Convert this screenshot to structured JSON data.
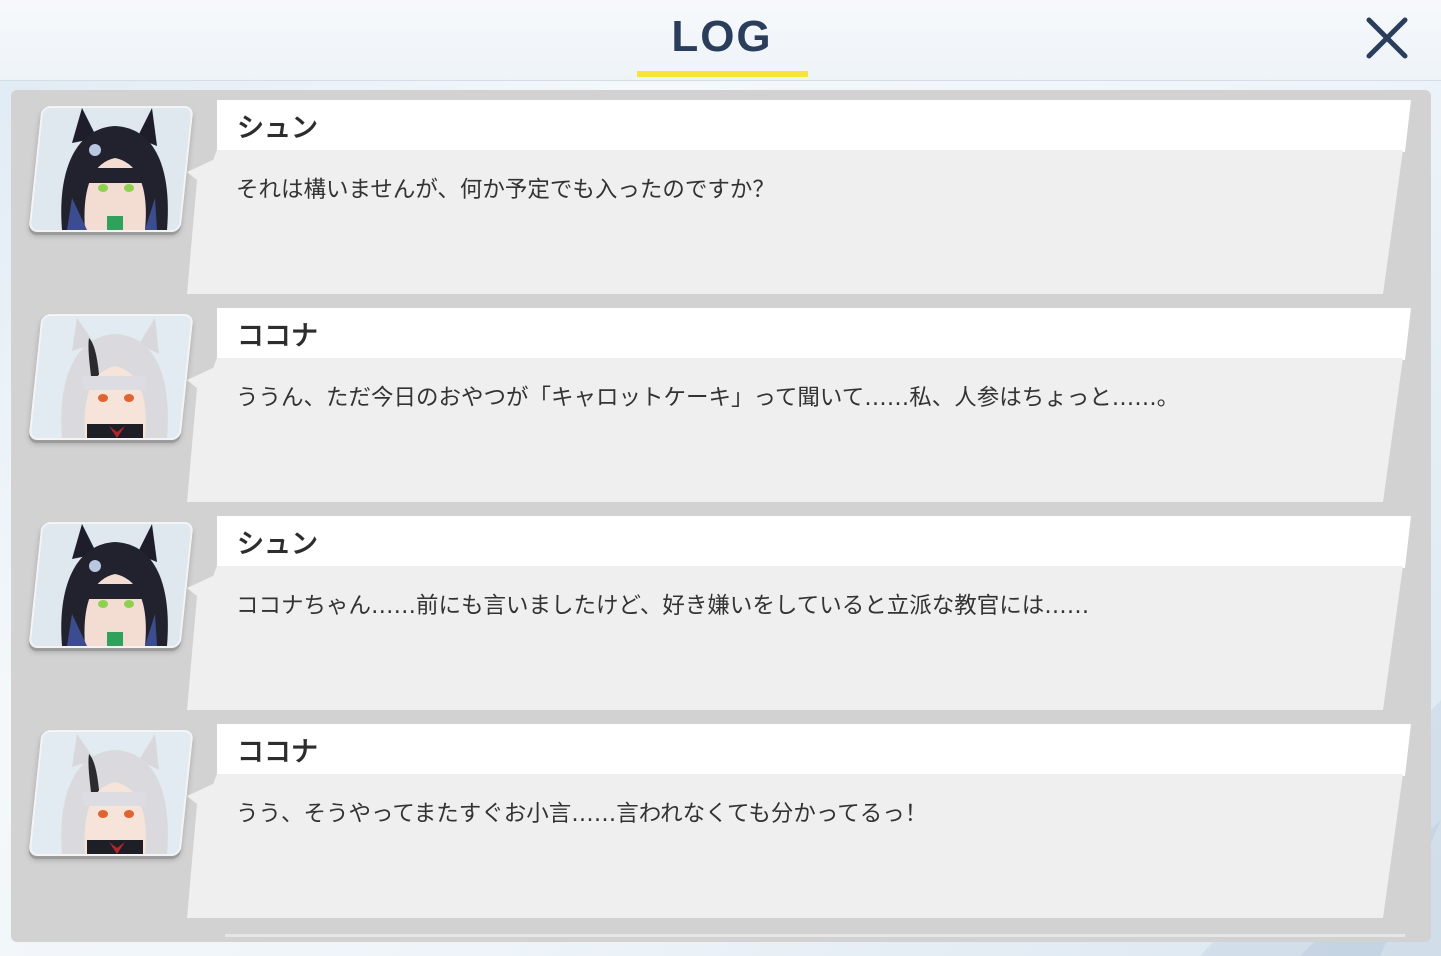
{
  "header": {
    "title": "LOG",
    "close_icon": "close-icon"
  },
  "colors": {
    "accent_underline": "#f7e33a",
    "title": "#2a3d5a",
    "panel": "#d2d2d2",
    "bubble": "#efefef"
  },
  "log": [
    {
      "speaker": "シュン",
      "avatar": "shun-portrait",
      "text": "それは構いませんが、何か予定でも入ったのですか？"
    },
    {
      "speaker": "ココナ",
      "avatar": "kokona-portrait",
      "text": "ううん、ただ今日のおやつが「キャロットケーキ」って聞いて……私、人参はちょっと……。"
    },
    {
      "speaker": "シュン",
      "avatar": "shun-portrait",
      "text": "ココナちゃん……前にも言いましたけど、好き嫌いをしていると立派な教官には……"
    },
    {
      "speaker": "ココナ",
      "avatar": "kokona-portrait",
      "text": "うう、そうやってまたすぐお小言……言われなくても分かってるっ！"
    }
  ]
}
